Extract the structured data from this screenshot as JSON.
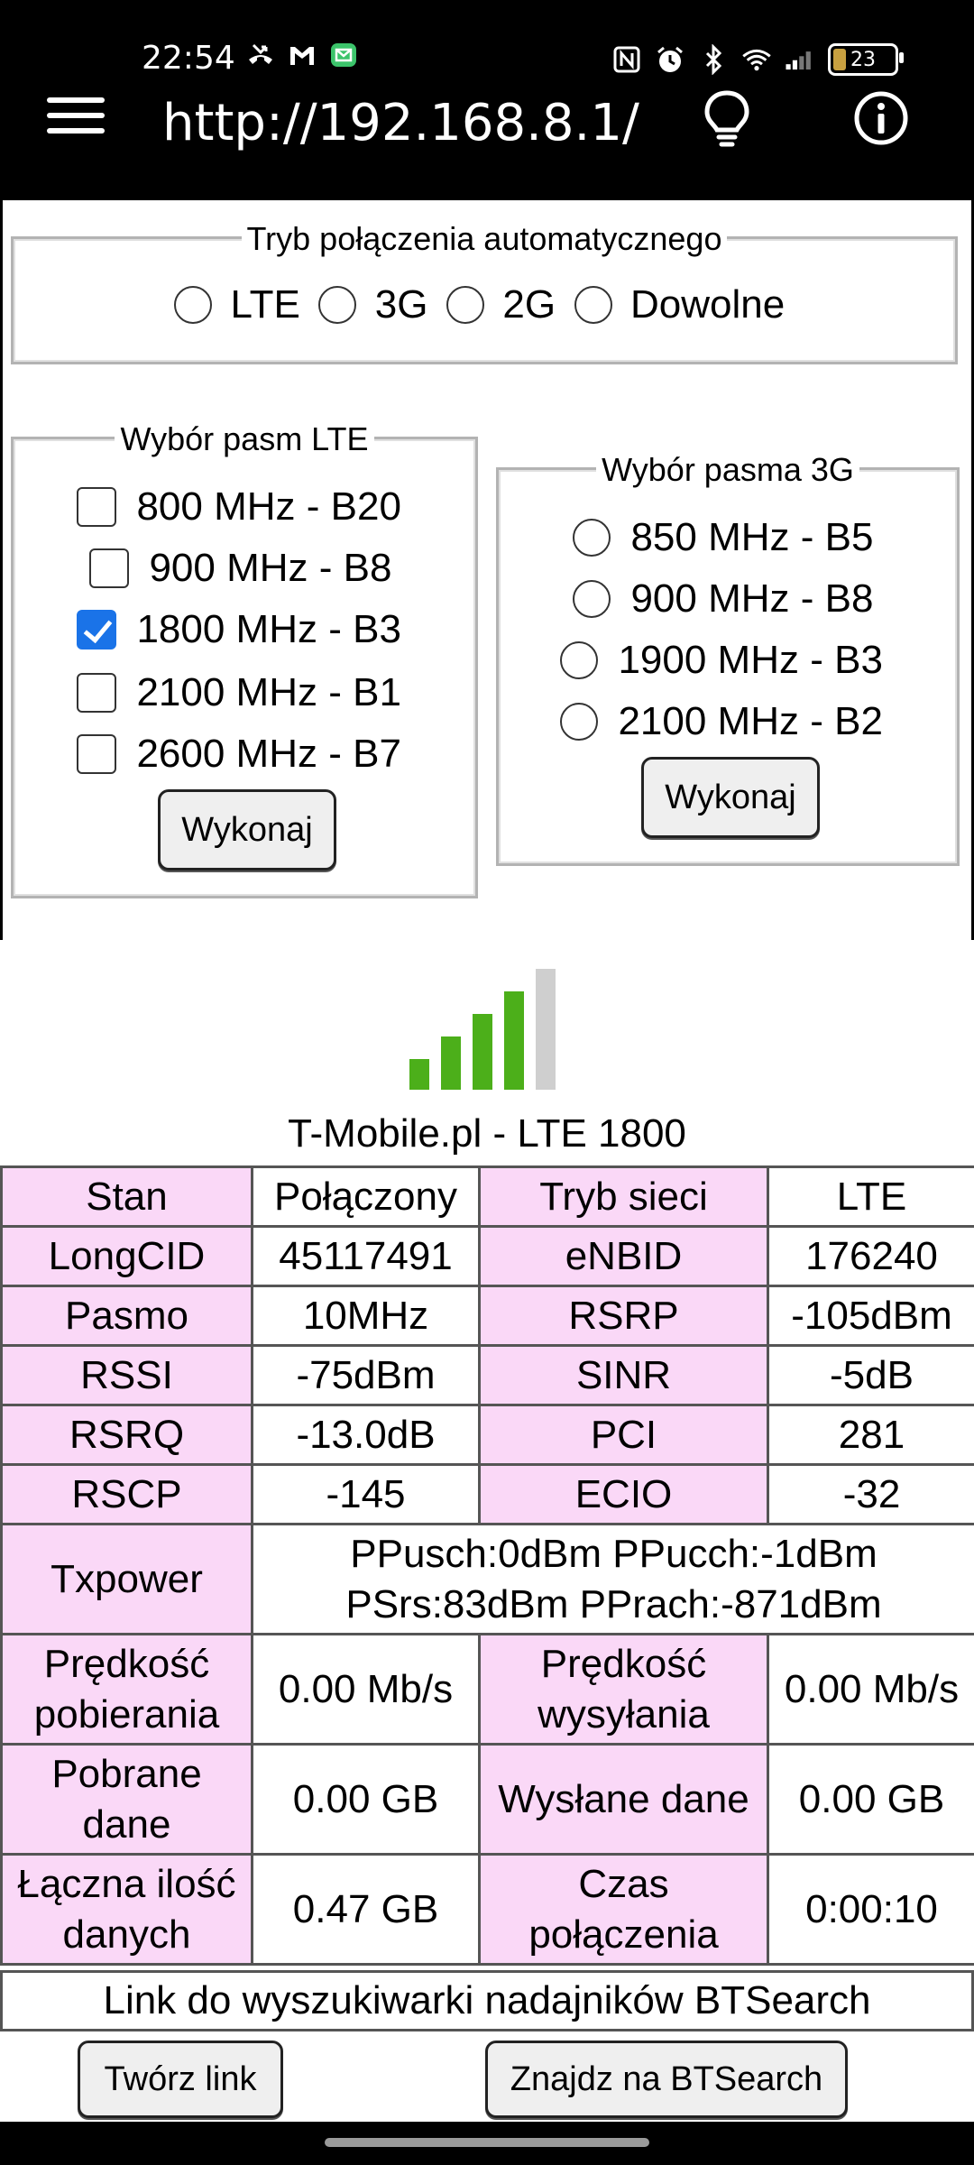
{
  "status": {
    "time": "22:54",
    "battery": "23",
    "left_icons": [
      "missed-call-icon",
      "gmail-icon",
      "message-icon"
    ],
    "right_icons": [
      "nfc-icon",
      "alarm-icon",
      "bluetooth-icon",
      "wifi-icon",
      "signal-icon"
    ]
  },
  "appbar": {
    "url": "http://192.168.8.1/"
  },
  "auto_mode": {
    "legend": "Tryb połączenia automatycznego",
    "options": [
      "LTE",
      "3G",
      "2G",
      "Dowolne"
    ]
  },
  "lte_bands": {
    "legend": "Wybór pasm LTE",
    "options": [
      {
        "label": "800 MHz - B20",
        "checked": false
      },
      {
        "label": "900 MHz - B8",
        "checked": false
      },
      {
        "label": "1800 MHz - B3",
        "checked": true
      },
      {
        "label": "2100 MHz - B1",
        "checked": false
      },
      {
        "label": "2600 MHz - B7",
        "checked": false
      }
    ],
    "button": "Wykonaj"
  },
  "umts_bands": {
    "legend": "Wybór pasma 3G",
    "options": [
      "850 MHz - B5",
      "900 MHz - B8",
      "1900 MHz - B3",
      "2100 MHz - B2"
    ],
    "button": "Wykonaj"
  },
  "signal": {
    "bars_active": 4,
    "bars_total": 5,
    "active_color": "#4caf1a",
    "inactive_color": "#cfcfcf"
  },
  "operator": "T-Mobile.pl - LTE 1800",
  "stats": {
    "stan_l": "Stan",
    "stan_v": "Połączony",
    "tryb_l": "Tryb sieci",
    "tryb_v": "LTE",
    "cid_l": "LongCID",
    "cid_v": "45117491",
    "enb_l": "eNBID",
    "enb_v": "176240",
    "pasmo_l": "Pasmo",
    "pasmo_v": "10MHz",
    "rsrp_l": "RSRP",
    "rsrp_v": "-105dBm",
    "rssi_l": "RSSI",
    "rssi_v": "-75dBm",
    "sinr_l": "SINR",
    "sinr_v": "-5dB",
    "rsrq_l": "RSRQ",
    "rsrq_v": "-13.0dB",
    "pci_l": "PCI",
    "pci_v": "281",
    "rscp_l": "RSCP",
    "rscp_v": "-145",
    "ecio_l": "ECIO",
    "ecio_v": "-32",
    "tx_l": "Txpower",
    "tx_v1": "PPusch:0dBm PPucch:-1dBm",
    "tx_v2": "PSrs:83dBm PPrach:-871dBm",
    "dl_l1": "Prędkość",
    "dl_l2": "pobierania",
    "dl_v": "0.00 Mb/s",
    "ul_l1": "Prędkość",
    "ul_l2": "wysyłania",
    "ul_v": "0.00 Mb/s",
    "down_l1": "Pobrane",
    "down_l2": "dane",
    "down_v": "0.00 GB",
    "up_l": "Wysłane dane",
    "up_v": "0.00 GB",
    "tot_l1": "Łączna ilość",
    "tot_l2": "danych",
    "tot_v": "0.47 GB",
    "time_l1": "Czas",
    "time_l2": "połączenia",
    "time_v": "0:00:10"
  },
  "btsearch": {
    "caption": "Link do wyszukiwarki nadajników BTSearch",
    "create_button": "Twórz link",
    "find_button": "Znajdz na BTSearch"
  }
}
